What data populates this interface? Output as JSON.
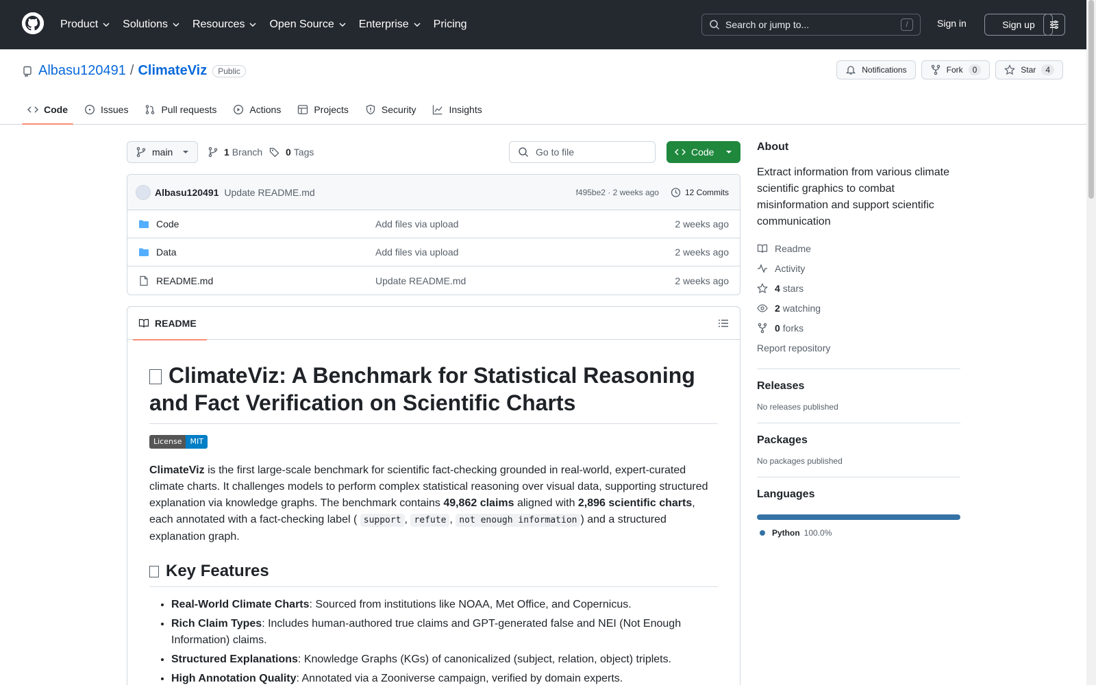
{
  "topnav": {
    "items": [
      "Product",
      "Solutions",
      "Resources",
      "Open Source",
      "Enterprise",
      "Pricing"
    ],
    "search_placeholder": "Search or jump to...",
    "search_shortcut": "/",
    "sign_in": "Sign in",
    "sign_up": "Sign up"
  },
  "repo": {
    "owner": "Albasu120491",
    "separator": "/",
    "name": "ClimateViz",
    "visibility": "Public",
    "notifications_label": "Notifications",
    "fork_label": "Fork",
    "fork_count": "0",
    "star_label": "Star",
    "star_count": "4"
  },
  "tabs": [
    "Code",
    "Issues",
    "Pull requests",
    "Actions",
    "Projects",
    "Security",
    "Insights"
  ],
  "toolbar": {
    "branch": "main",
    "branch_count": "1",
    "branch_label": "Branch",
    "tag_count": "0",
    "tag_label": "Tags",
    "goto_placeholder": "Go to file",
    "code_button": "Code"
  },
  "latest_commit": {
    "author": "Albasu120491",
    "message": "Update README.md",
    "meta": "f495be2 · 2 weeks ago",
    "commits": "12 Commits"
  },
  "files": [
    {
      "name": "Code",
      "type": "folder",
      "commit": "Add files via upload",
      "time": "2 weeks ago"
    },
    {
      "name": "Data",
      "type": "folder",
      "commit": "Add files via upload",
      "time": "2 weeks ago"
    },
    {
      "name": "README.md",
      "type": "file",
      "commit": "Update README.md",
      "time": "2 weeks ago"
    }
  ],
  "readme": {
    "tab_label": "README",
    "title": "ClimateViz: A Benchmark for Statistical Reasoning and Fact Verification on Scientific Charts",
    "badge_left": "License",
    "badge_right": "MIT",
    "intro": {
      "name": "ClimateViz",
      "p1": " is the first large-scale benchmark for scientific fact-checking grounded in real-world, expert-curated climate charts. It challenges models to perform complex statistical reasoning over visual data, supporting structured explanation via knowledge graphs. The benchmark contains ",
      "claims": "49,862 claims",
      "p2": " aligned with ",
      "charts": "2,896 scientific charts",
      "p3": ", each annotated with a fact-checking label (",
      "label1": "support",
      "comma1": ", ",
      "label2": "refute",
      "comma2": ", ",
      "label3": "not enough information",
      "p4": ") and a structured explanation graph."
    },
    "features_title": "Key Features",
    "features": [
      {
        "term": "Real-World Climate Charts",
        "desc": ": Sourced from institutions like NOAA, Met Office, and Copernicus."
      },
      {
        "term": "Rich Claim Types",
        "desc": ": Includes human-authored true claims and GPT-generated false and NEI (Not Enough Information) claims."
      },
      {
        "term": "Structured Explanations",
        "desc": ": Knowledge Graphs (KGs) of canonicalized (subject, relation, object) triplets."
      },
      {
        "term": "High Annotation Quality",
        "desc": ": Annotated via a Zooniverse campaign, verified by domain experts."
      }
    ]
  },
  "about": {
    "title": "About",
    "description": "Extract information from various climate scientific graphics to combat misinformation and support scientific communication",
    "readme": "Readme",
    "activity": "Activity",
    "stars_count": "4",
    "stars_label": "stars",
    "watching_count": "2",
    "watching_label": "watching",
    "forks_count": "0",
    "forks_label": "forks",
    "report": "Report repository"
  },
  "releases": {
    "title": "Releases",
    "text": "No releases published"
  },
  "packages": {
    "title": "Packages",
    "text": "No packages published"
  },
  "languages": {
    "title": "Languages",
    "items": [
      {
        "name": "Python",
        "percent": "100.0%",
        "color": "#3572A5"
      }
    ]
  }
}
